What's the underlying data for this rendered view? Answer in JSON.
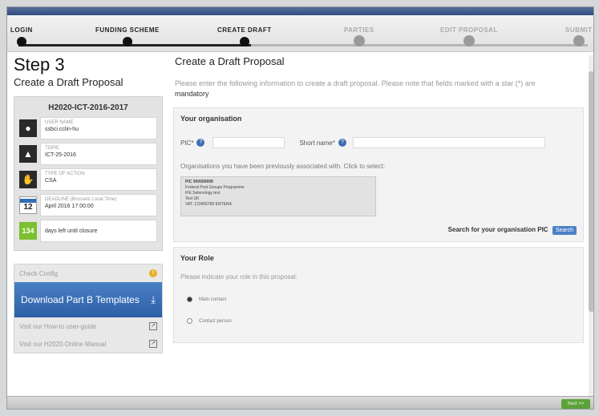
{
  "steps": [
    {
      "label": "LOGIN",
      "state": "done"
    },
    {
      "label": "FUNDING SCHEME",
      "state": "done"
    },
    {
      "label": "CREATE DRAFT",
      "state": "current"
    },
    {
      "label": "PARTIES",
      "state": "todo"
    },
    {
      "label": "EDIT PROPOSAL",
      "state": "todo"
    },
    {
      "label": "SUBMIT",
      "state": "todo"
    }
  ],
  "left": {
    "step_title": "Step 3",
    "step_subtitle": "Create a Draft Proposal",
    "call_id": "H2020-ICT-2016-2017",
    "info": [
      {
        "icon": "user-icon",
        "key": "USER NAME",
        "value": "ssbci.cclin-hu"
      },
      {
        "icon": "topic-icon",
        "key": "TOPIC",
        "value": "ICT-25-2016"
      },
      {
        "icon": "action-type-icon",
        "key": "TYPE OF ACTION",
        "value": "CSA"
      },
      {
        "icon": "calendar-icon",
        "key": "DEADLINE (Brussels Local Time)",
        "value": "April 2016 17:00:00",
        "cal_day": "12"
      },
      {
        "icon": "days-left-icon",
        "key": "",
        "value": "days left until closure",
        "days": "134"
      }
    ],
    "menu": {
      "check_config": "Check Config",
      "download": "Download Part B Templates",
      "howto": "Visit our How-to user-guide",
      "portal": "Visit our H2020 Online Manual"
    }
  },
  "main": {
    "title": "Create a Draft Proposal",
    "intro_prefix": "Please enter the following information to create a draft proposal. Please note that fields marked with a star (*) are ",
    "intro_bold": "mandatory",
    "org": {
      "title": "Your organisation",
      "pic_label": "PIC*",
      "short_label": "Short name*",
      "assoc_text": "Organisations you have been previously associated with. Click to select:",
      "org_lines": [
        "PIC 999999999",
        "Federal Post Groups Programme",
        "IFE Selenology test",
        "Test UK",
        "VAT: 123456789 ENTERA"
      ],
      "search_label": "Search for your organisation PIC",
      "search_button": "Search"
    },
    "role": {
      "title": "Your Role",
      "question": "Please indicate your role in this proposal:",
      "options": [
        "Main contact",
        "Contact person"
      ]
    }
  },
  "footer": {
    "next_button": "Next >>"
  }
}
